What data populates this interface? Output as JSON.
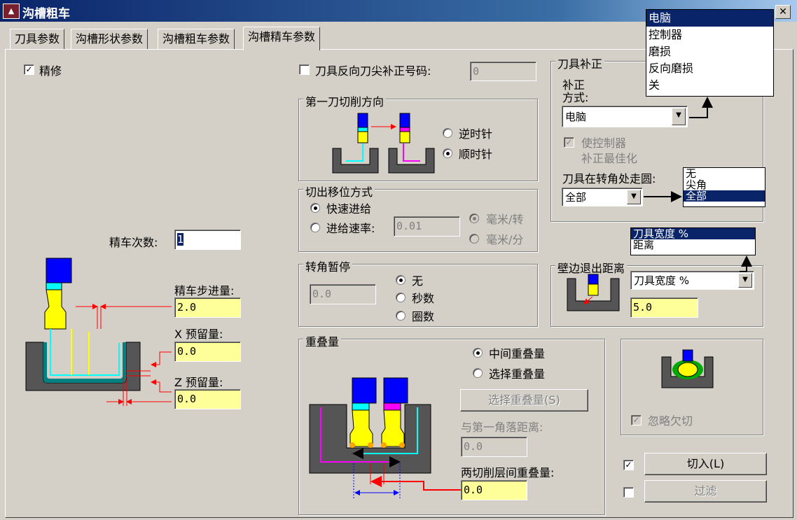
{
  "window": {
    "title": "沟槽粗车",
    "close_glyph": "✕"
  },
  "tabs": [
    {
      "label": "刀具参数"
    },
    {
      "label": "沟槽形状参数"
    },
    {
      "label": "沟槽粗车参数"
    },
    {
      "label": "沟槽精车参数",
      "active": true
    }
  ],
  "finish": {
    "label": "精修",
    "checked": true
  },
  "reverse_tool": {
    "label": "刀具反向刀尖补正号码:",
    "value": "0",
    "checked": false
  },
  "finish_passes": {
    "label": "精车次数:",
    "value": "1"
  },
  "finish_stepover": {
    "label": "精车步进量:",
    "value": "2.0"
  },
  "x_stock": {
    "label": "X 预留量:",
    "value": "0.0"
  },
  "z_stock": {
    "label": "Z 预留量:",
    "value": "0.0"
  },
  "first_cut_direction": {
    "title": "第一刀切削方向",
    "options": [
      {
        "label": "逆时针",
        "selected": false
      },
      {
        "label": "顺时针",
        "selected": true
      }
    ]
  },
  "retract": {
    "title": "切出移位方式",
    "rapid_label": "快速进给",
    "feed_label": "进给速率:",
    "feed_value": "0.01",
    "units": [
      "毫米/转",
      "毫米/分"
    ]
  },
  "corner_dwell": {
    "title": "转角暂停",
    "value": "0.0",
    "options": [
      "无",
      "秒数",
      "圈数"
    ]
  },
  "overlap": {
    "title": "重叠量",
    "options": [
      "中间重叠量",
      "选择重叠量"
    ],
    "select_button": "选择重叠量(S)",
    "corner_distance_label": "与第一角落距离:",
    "corner_distance_value": "0.0",
    "between_label": "两切削层间重叠量:",
    "between_value": "0.0"
  },
  "tool_comp": {
    "title": "刀具补正",
    "mode_label_line1": "补正",
    "mode_label_line2": "方式:",
    "mode_value": "电脑",
    "mode_options": [
      "电脑",
      "控制器",
      "磨损",
      "反向磨损",
      "关"
    ],
    "optimize_line1": "使控制器",
    "optimize_line2": "补正最佳化",
    "corner_label": "刀具在转角处走圆:",
    "corner_value": "全部",
    "corner_options": [
      "无",
      "尖角",
      "全部"
    ]
  },
  "wall_backoff": {
    "title": "壁边退出距离",
    "mode_value": "刀具宽度 %",
    "mode_options": [
      "刀具宽度 %",
      "距离"
    ],
    "value": "5.0"
  },
  "ignore_undercut": {
    "label": "忽略欠切",
    "checked": true
  },
  "plunge": {
    "label": "切入(L)",
    "checked": true
  },
  "filter": {
    "label": "过滤",
    "checked": false
  },
  "colors": {
    "title_start": "#0a246a",
    "title_end": "#a6caf0",
    "dialog_bg": "#d4d0c8",
    "input_yellow": "#ffff99",
    "selection": "#0a246a",
    "tool_body": "#0000ff",
    "tool_insert": "#ffff00",
    "tool_holder": "#00ffff",
    "part_fill": "#555555",
    "dimension": "#ff0000",
    "path_magenta": "#ff00ff"
  }
}
